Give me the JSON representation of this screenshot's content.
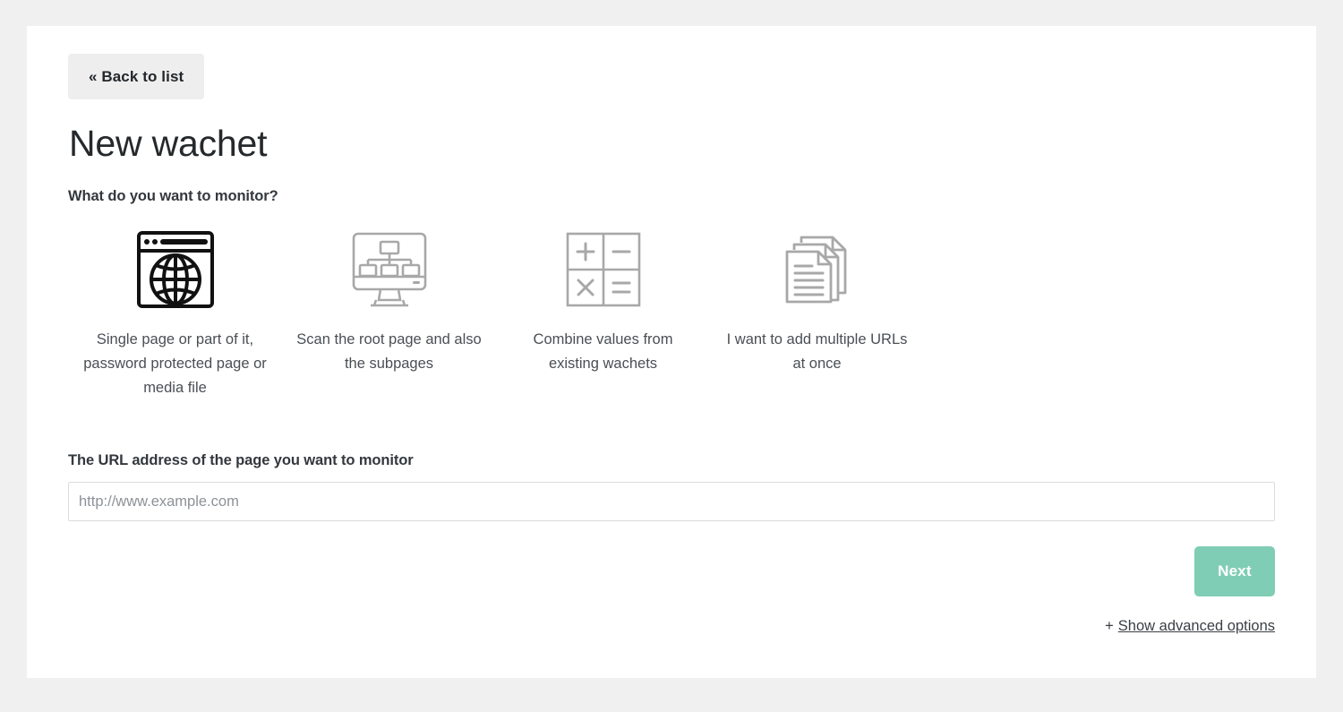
{
  "page": {
    "background_color": "#f0f0f0",
    "card_background": "#ffffff",
    "title": "New wachet"
  },
  "back_button": {
    "label": "« Back to list",
    "icon": "double-chevron-left-icon"
  },
  "monitor_section": {
    "question": "What do you want to monitor?",
    "options": [
      {
        "id": "single-page",
        "icon": "browser-globe-icon",
        "icon_color": "#111111",
        "label": "Single page or part of it, password protected page or media file"
      },
      {
        "id": "scan-root-page",
        "icon": "monitor-sitemap-icon",
        "icon_color": "#a8a8a8",
        "label": "Scan the root page and also the subpages"
      },
      {
        "id": "combine-values",
        "icon": "calculator-grid-icon",
        "icon_color": "#a8a8a8",
        "label": "Combine values from existing wachets"
      },
      {
        "id": "multiple-urls",
        "icon": "stacked-documents-icon",
        "icon_color": "#a8a8a8",
        "label": "I want to add multiple URLs at once"
      }
    ]
  },
  "url_field": {
    "label": "The URL address of the page you want to monitor",
    "placeholder": "http://www.example.com",
    "value": ""
  },
  "footer": {
    "next_label": "Next",
    "next_color": "#7fcdb4",
    "advanced_plus": "+",
    "advanced_label": "Show advanced options"
  }
}
